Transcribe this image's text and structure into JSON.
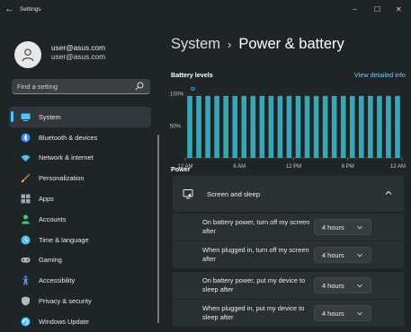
{
  "window": {
    "back_icon": "←",
    "title": "Settings",
    "min_icon": "−",
    "max_icon": "☐",
    "close_icon": "✕"
  },
  "account": {
    "line1": "user@asus.com",
    "line2": "user@asus.com"
  },
  "search": {
    "placeholder": "Find a setting",
    "value": ""
  },
  "nav": [
    {
      "label": "System",
      "icon": "monitor-icon",
      "color": "#4cc2ff",
      "active": true
    },
    {
      "label": "Bluetooth & devices",
      "icon": "bluetooth-icon",
      "color": "#2f8dff",
      "active": false
    },
    {
      "label": "Network & internet",
      "icon": "wifi-icon",
      "color": "#4cc2ff",
      "active": false
    },
    {
      "label": "Personalization",
      "icon": "brush-icon",
      "color": "#f09a3c",
      "active": false
    },
    {
      "label": "Apps",
      "icon": "apps-icon",
      "color": "#9aa8b8",
      "active": false
    },
    {
      "label": "Accounts",
      "icon": "person-icon",
      "color": "#3fcf7a",
      "active": false
    },
    {
      "label": "Time & language",
      "icon": "globe-clock-icon",
      "color": "#4cc2ff",
      "active": false
    },
    {
      "label": "Gaming",
      "icon": "gamepad-icon",
      "color": "#b8b8b8",
      "active": false
    },
    {
      "label": "Accessibility",
      "icon": "accessibility-icon",
      "color": "#4c9bff",
      "active": false
    },
    {
      "label": "Privacy & security",
      "icon": "shield-icon",
      "color": "#b0b8c0",
      "active": false
    },
    {
      "label": "Windows Update",
      "icon": "update-icon",
      "color": "#4cc2ff",
      "active": false
    }
  ],
  "breadcrumb": {
    "parent": "System",
    "separator": "›",
    "current": "Power & battery"
  },
  "battery": {
    "heading": "Battery levels",
    "link": "View detailed info",
    "y_ticks": [
      "100%",
      "50%"
    ],
    "x_ticks": [
      "12 AM",
      "6 AM",
      "12 PM",
      "6 PM",
      "12 AM"
    ],
    "bar_count": 24,
    "levels": [
      0.96,
      0.96,
      0.96,
      0.96,
      0.96,
      0.96,
      0.96,
      0.96,
      0.96,
      0.96,
      0.96,
      0.96,
      0.96,
      0.96,
      0.96,
      0.96,
      0.96,
      0.96,
      0.96,
      0.96,
      0.96,
      0.96,
      0.96,
      0.96
    ],
    "bar_color": "#37a7b7",
    "plug_marker": "ϖ"
  },
  "power": {
    "heading": "Power",
    "card_title": "Screen and sleep",
    "rows": [
      {
        "label": "On battery power, turn off my screen after",
        "value": "4 hours"
      },
      {
        "label": "When plugged in, turn off my screen after",
        "value": "4 hours"
      },
      {
        "label": "On battery power, put my device to sleep after",
        "value": "4 hours"
      },
      {
        "label": "When plugged in, put my device to sleep after",
        "value": "4 hours"
      }
    ]
  }
}
